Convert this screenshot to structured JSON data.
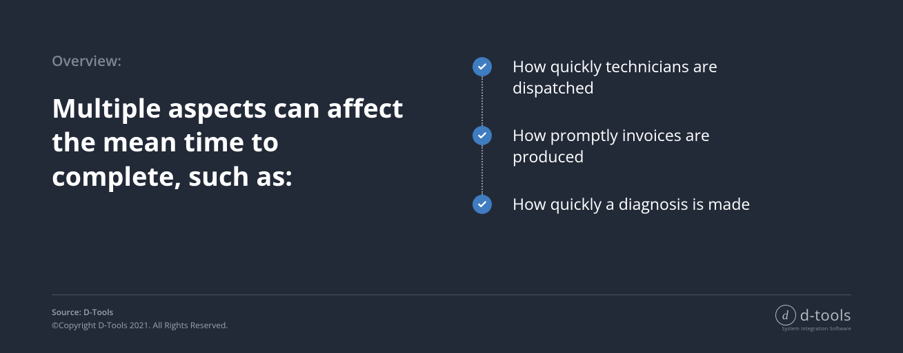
{
  "overview": {
    "label": "Overview:",
    "heading": "Multiple aspects can affect the mean time to complete, such as:"
  },
  "bullets": {
    "items": [
      "How quickly technicians are dispatched",
      "How promptly invoices are produced",
      "How quickly a diagnosis is made"
    ]
  },
  "footer": {
    "source_label": "Source: D-Tools",
    "copyright": "©Copyright D-Tools 2021. All Rights Reserved."
  },
  "logo": {
    "letter": "d",
    "text": "d-tools",
    "tagline": "System Integration Software"
  },
  "colors": {
    "background": "#222a38",
    "accent": "#3f7cc0",
    "text_primary": "#ffffff",
    "text_muted": "#7e8791"
  }
}
